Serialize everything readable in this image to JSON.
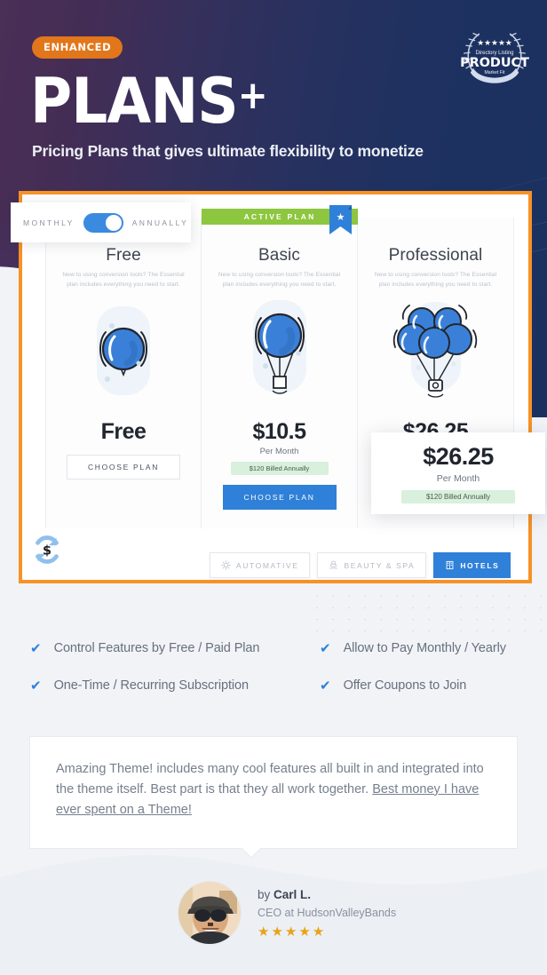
{
  "hero": {
    "badge": "ENHANCED",
    "title": "PLANS",
    "title_plus": "+",
    "subtitle": "Pricing Plans that gives ultimate flexibility to monetize",
    "award": {
      "top_text": "Directory Listing",
      "main_text": "PRODUCT",
      "bottom_text": "Market Fit",
      "stars": "★ ★ ★ ★ ★"
    },
    "colors": {
      "gradient_start": "#4a2f56",
      "gradient_end": "#1a3160",
      "badge_bg": "#e2761b"
    }
  },
  "billing_toggle": {
    "left_label": "MONTHLY",
    "right_label": "ANNUALLY",
    "state": "monthly",
    "accent": "#3a8ae0"
  },
  "pricing": {
    "frame_color": "#f79226",
    "active_ribbon_label": "ACTIVE PLAN",
    "ribbon_color": "#8dc63f",
    "plans": [
      {
        "name": "Free",
        "description": "New to using conversion tools? The Essential plan includes everything you need to start.",
        "price": "Free",
        "period": "",
        "billed_note": "",
        "cta": "CHOOSE PLAN",
        "active": false,
        "illustration": "single-balloon-icon"
      },
      {
        "name": "Basic",
        "description": "New to using conversion tools? The Essential plan includes everything you need to start.",
        "price": "$10.5",
        "period": "Per Month",
        "billed_note": "$120 Billed Annually",
        "cta": "CHOOSE PLAN",
        "active": true,
        "illustration": "hot-air-balloon-icon"
      },
      {
        "name": "Professional",
        "description": "New to using conversion tools? The Essential plan includes everything you need to start.",
        "price": "$26.25",
        "period": "Per Month",
        "billed_note": "$120 Billed Annually",
        "cta": "CHOOSE PLAN",
        "active": false,
        "illustration": "balloon-cluster-icon"
      }
    ],
    "popup": {
      "price": "$26.25",
      "period": "Per Month",
      "billed_note": "$120 Billed Annually"
    }
  },
  "categories": [
    {
      "label": "AUTOMATIVE",
      "icon": "gear-icon",
      "active": false
    },
    {
      "label": "BEAUTY & SPA",
      "icon": "spa-icon",
      "active": false
    },
    {
      "label": "HOTELS",
      "icon": "hotel-icon",
      "active": true
    }
  ],
  "features": [
    "Control Features by Free / Paid Plan",
    "Allow to Pay Monthly / Yearly",
    "One-Time / Recurring Subscription",
    "Offer Coupons to Join"
  ],
  "testimonial": {
    "text_plain": "Amazing Theme! includes many cool features all built in and integrated into the theme itself. Best part is that they all work together. ",
    "text_underlined": "Best money I have ever spent on a Theme! ",
    "author_prefix": "by ",
    "author_name": "Carl L.",
    "author_role": "CEO at HudsonValleyBands",
    "stars": "★★★★★",
    "star_color": "#e8a317"
  }
}
